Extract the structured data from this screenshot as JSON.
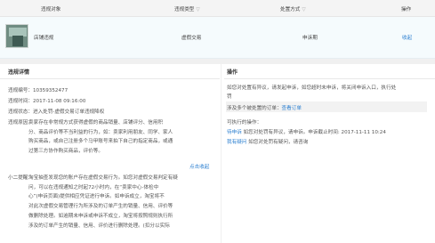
{
  "table": {
    "headers": {
      "object": "违规对象",
      "type": "违规类型",
      "handling": "处置方式",
      "action": "操作"
    },
    "filter_icon": "▽",
    "row": {
      "name": "店铺违规",
      "type": "虚假交易",
      "handling": "申诉期",
      "action": "收起"
    }
  },
  "details": {
    "title": "违规详情",
    "id_label": "违规编号：",
    "id_value": "10359352477",
    "time_label": "违规时间：",
    "time_value": "2017-11-08 09:16:00",
    "status_label": "违规状态：",
    "status_value": "进入处罚-虚假交易订单违规降权",
    "reason_label": "违规原因：",
    "reason_lines": [
      "卖家存在非常规方式获得虚假的商品销量、店铺评分、信用积",
      "分、商品评价等不当利益的行为，如：卖家利用朋友、同学、家人",
      "购买商品，或自己注册多个马甲账号来拍下自己的指定商品，或通",
      "过第三方协作购买商品，评价等。"
    ],
    "collapse_link": "点击收起",
    "tip_label": "小二提醒：",
    "tip_lines": [
      "淘宝抽查发现您的账户存在虚假交易行为。如您对虚假交易判定有疑",
      "问，可以在违规通知之时起72小时内，在“卖家中心-体检中",
      "心”(申诉页面)提供相应凭证进行申诉。如申诉成立，淘宝将不",
      "对此次虚假交易管理行为所涉及的订单产生的销量、信用、评价等",
      "做删除处理。如逾期未申诉或申诉不成立，淘宝将按照规则执行所",
      "涉及的订单产生的销量、信用、评价进行删除处理。(扣分以实际"
    ]
  },
  "operations": {
    "title": "操作",
    "desc_lines": [
      "如您对处置有异议，请发起申诉，如您超时未申诉，将关闭申诉入口，执行处",
      "罚"
    ],
    "orders_prefix": "涉及多个被处置的订单：",
    "orders_link": "查看订单",
    "exec_label": "可执行的操作：",
    "op1_link": "待申诉",
    "op1_text": "如您对处罚有异议，请申诉。申诉截止时间: 2017-11-11 10:24",
    "op2_link": "我有疑问",
    "op2_text": "如您对处罚有疑问，请咨询"
  }
}
